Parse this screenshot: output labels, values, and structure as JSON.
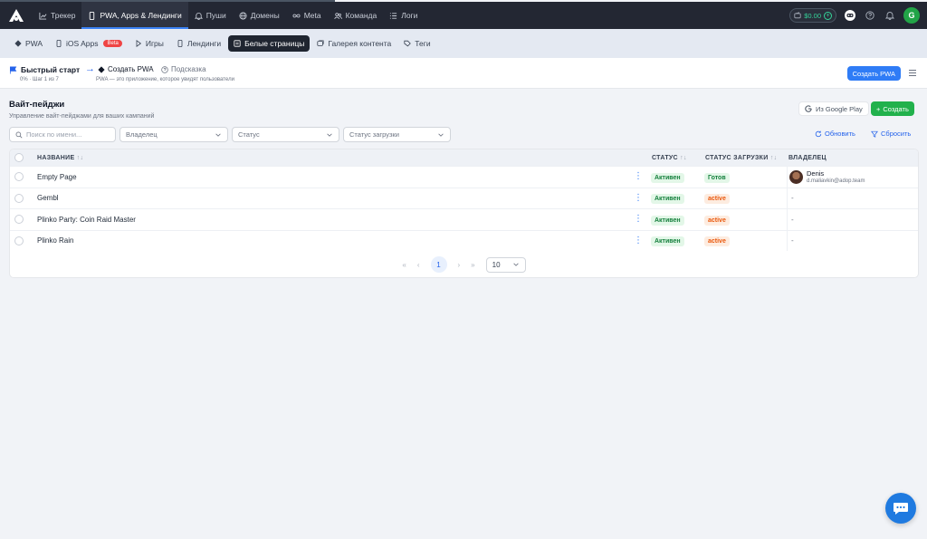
{
  "topnav": {
    "items": [
      {
        "label": "Трекер",
        "icon": "chart-line-icon"
      },
      {
        "label": "PWA, Apps & Лендинги",
        "icon": "smartphone-icon"
      },
      {
        "label": "Пуши",
        "icon": "bell-icon"
      },
      {
        "label": "Домены",
        "icon": "globe-icon"
      },
      {
        "label": "Meta",
        "icon": "infinity-icon"
      },
      {
        "label": "Команда",
        "icon": "users-icon"
      },
      {
        "label": "Логи",
        "icon": "list-icon"
      }
    ],
    "active_index": 1,
    "balance": "$0.00",
    "user_initial": "G"
  },
  "subnav": {
    "items": [
      {
        "label": "PWA",
        "icon": "android-icon"
      },
      {
        "label": "iOS Apps",
        "icon": "smartphone-icon",
        "badge": "Beta"
      },
      {
        "label": "Игры",
        "icon": "play-icon"
      },
      {
        "label": "Лендинги",
        "icon": "smartphone-icon"
      },
      {
        "label": "Белые страницы",
        "icon": "page-icon"
      },
      {
        "label": "Галерея контента",
        "icon": "gallery-icon"
      },
      {
        "label": "Теги",
        "icon": "tag-icon"
      }
    ],
    "active_index": 4
  },
  "quickstart": {
    "title": "Быстрый старт",
    "progress": "0% · Шаг 1 из 7",
    "step": "Создать PWA",
    "hint": "Подсказка",
    "description": "PWA — это приложение, которое увидят пользователи",
    "create_button": "Создать PWA"
  },
  "page": {
    "title": "Вайт-пейджи",
    "subtitle": "Управление вайт-пейджами для ваших кампаний",
    "google_button": "Из Google Play",
    "create_button": "Создать"
  },
  "filters": {
    "search_placeholder": "Поиск по имени...",
    "owner": "Владелец",
    "status": "Статус",
    "upload_status": "Статус загрузки",
    "refresh": "Обновить",
    "reset": "Сбросить"
  },
  "table": {
    "columns": {
      "name": "НАЗВАНИЕ",
      "status": "СТАТУС",
      "upload": "СТАТУС ЗАГРУЗКИ",
      "owner": "ВЛАДЕЛЕЦ"
    },
    "rows": [
      {
        "name": "Empty Page",
        "status": "Активен",
        "upload": "Готов",
        "upload_color": "green",
        "owner_name": "Denis",
        "owner_email": "d.maliavkin@adop.team"
      },
      {
        "name": "Gembl",
        "status": "Активен",
        "upload": "active",
        "upload_color": "orange",
        "owner": "-"
      },
      {
        "name": "Plinko Party: Coin Raid Master",
        "status": "Активен",
        "upload": "active",
        "upload_color": "orange",
        "owner": "-"
      },
      {
        "name": "Plinko Rain",
        "status": "Активен",
        "upload": "active",
        "upload_color": "orange",
        "owner": "-"
      }
    ]
  },
  "pagination": {
    "first": "«",
    "prev": "‹",
    "current": "1",
    "next": "›",
    "last": "»",
    "page_size": "10"
  },
  "colors": {
    "topbar": "#232733",
    "accent": "#2f7cf6",
    "create": "#22b14c",
    "active_tab": "#1f2530"
  }
}
